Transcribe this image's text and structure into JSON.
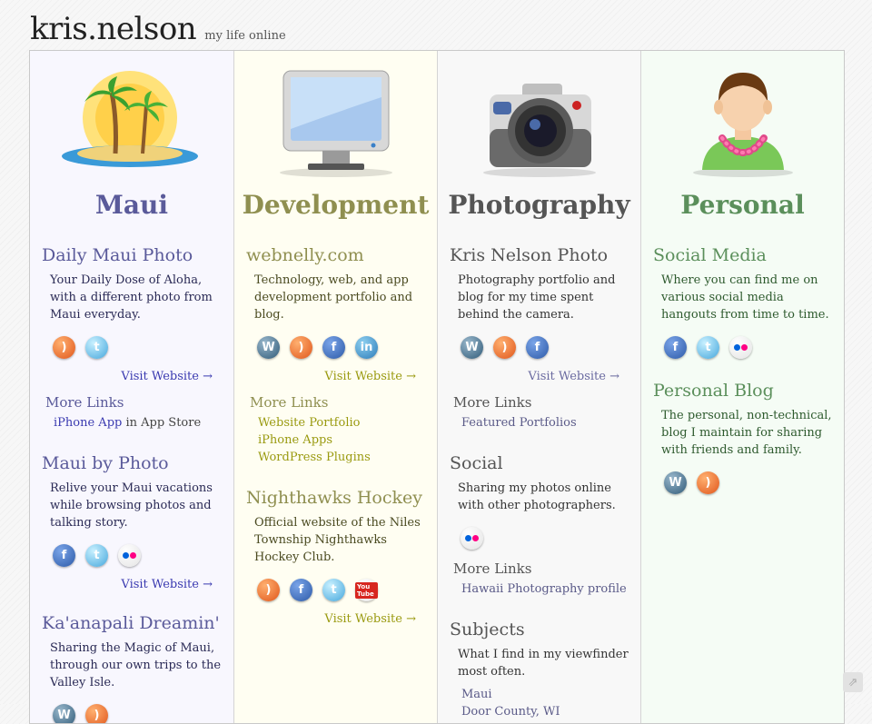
{
  "header": {
    "title": "kris.nelson",
    "tagline": "my life online"
  },
  "columns": {
    "maui": {
      "title": "Maui",
      "sections": [
        {
          "title": "Daily Maui Photo",
          "desc": "Your Daily Dose of Aloha, with a different photo from Maui everyday.",
          "icons": [
            "rss-icon",
            "twitter-icon"
          ],
          "visit": "Visit Website →",
          "more_title": "More Links",
          "more_link": "iPhone App",
          "more_suffix": " in App Store"
        },
        {
          "title": "Maui by Photo",
          "desc": "Relive your Maui vacations while browsing photos and talking story.",
          "icons": [
            "facebook-icon",
            "twitter-icon",
            "flickr-icon"
          ],
          "visit": "Visit Website →"
        },
        {
          "title": "Ka'anapali Dreamin'",
          "desc": "Sharing the Magic of Maui, through our own trips to the Valley Isle.",
          "icons": [
            "wordpress-icon",
            "rss-icon"
          ]
        }
      ]
    },
    "dev": {
      "title": "Development",
      "sections": [
        {
          "title": "webnelly.com",
          "desc": "Technology, web, and app development portfolio and blog.",
          "icons": [
            "wordpress-icon",
            "rss-icon",
            "facebook-icon",
            "linkedin-icon"
          ],
          "visit": "Visit Website →",
          "more_title": "More Links",
          "more_links": [
            "Website Portfolio",
            "iPhone Apps",
            "WordPress Plugins"
          ]
        },
        {
          "title": "Nighthawks Hockey",
          "desc": "Official website of the Niles Township Nighthawks Hockey Club.",
          "icons": [
            "rss-icon",
            "facebook-icon",
            "twitter-icon",
            "youtube-icon"
          ],
          "visit": "Visit Website →"
        }
      ]
    },
    "photo": {
      "title": "Photography",
      "sections": [
        {
          "title": "Kris Nelson Photo",
          "desc": "Photography portfolio and blog for my time spent behind the camera.",
          "icons": [
            "wordpress-icon",
            "rss-icon",
            "facebook-icon"
          ],
          "visit": "Visit Website →",
          "more_title": "More Links",
          "more_links": [
            "Featured Portfolios"
          ]
        },
        {
          "title": "Social",
          "desc": "Sharing my photos online with other photographers.",
          "icons": [
            "flickr-icon"
          ],
          "more_title": "More Links",
          "more_links": [
            "Hawaii Photography profile"
          ]
        },
        {
          "title": "Subjects",
          "desc": "What I find in my viewfinder most often.",
          "links": [
            "Maui",
            "Door County, WI"
          ]
        }
      ]
    },
    "personal": {
      "title": "Personal",
      "sections": [
        {
          "title": "Social Media",
          "desc": "Where you can find me on various social media hangouts from time to time.",
          "icons": [
            "facebook-icon",
            "twitter-icon",
            "flickr-icon"
          ]
        },
        {
          "title": "Personal Blog",
          "desc": "The personal, non-technical, blog I maintain for sharing with friends and family.",
          "icons": [
            "wordpress-icon",
            "rss-icon"
          ]
        }
      ]
    }
  },
  "icon_glyphs": {
    "rss": ")",
    "twitter": "t",
    "facebook": "f",
    "linkedin": "in",
    "wordpress": "W",
    "youtube": "You Tube"
  },
  "share_glyph": "⇗"
}
